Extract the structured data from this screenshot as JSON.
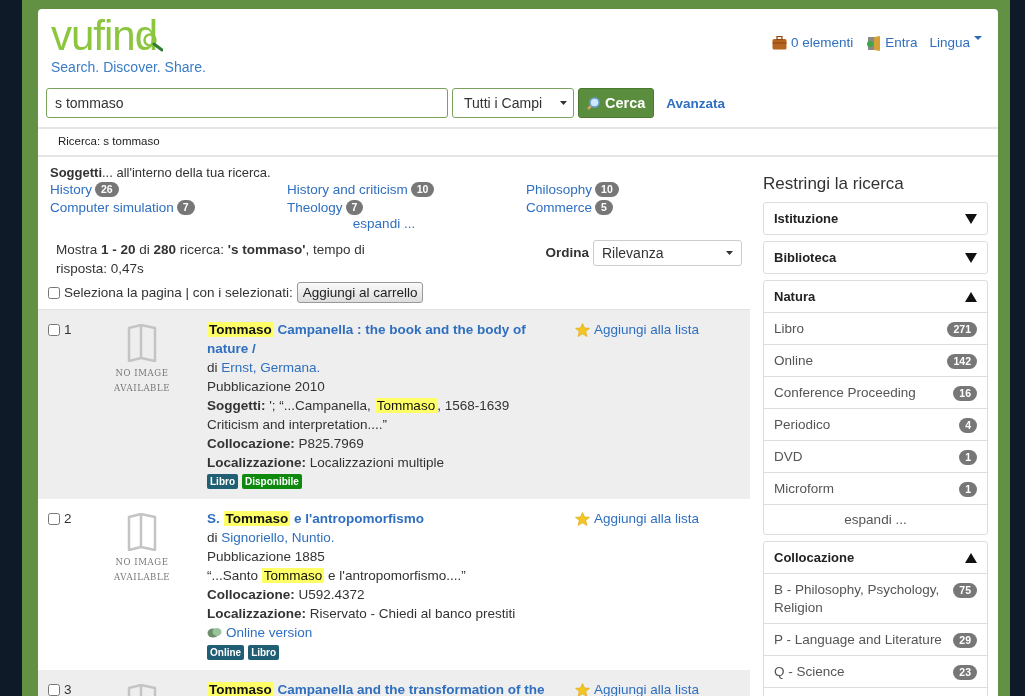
{
  "header": {
    "logo": "vufind",
    "tagline": "Search. Discover. Share.",
    "cart": "0 elementi",
    "login": "Entra",
    "language": "Lingua"
  },
  "search": {
    "value": "s tommaso",
    "type": "Tutti i Campi",
    "button": "Cerca",
    "advanced": "Avanzata"
  },
  "breadcrumb": "Ricerca: s tommaso",
  "subjects": {
    "intro": "**Soggetti**... all'interno della tua ricerca.",
    "items": [
      {
        "label": "History",
        "count": "26"
      },
      {
        "label": "History and criticism",
        "count": "10"
      },
      {
        "label": "Philosophy",
        "count": "10"
      },
      {
        "label": "Computer simulation",
        "count": "7"
      },
      {
        "label": "Theology",
        "count": "7"
      },
      {
        "label": "Commerce",
        "count": "5"
      }
    ],
    "more": "espandi ..."
  },
  "summary": "Mostra **1 - 20** di **280** ricerca: **'s tommaso'**, tempo di risposta: 0,47s",
  "sort": {
    "label": "Ordina",
    "value": "Rilevanza"
  },
  "bulk": {
    "checked": false,
    "label": "Seleziona la pagina | con i selezionati:",
    "button": "Aggiungi al carrello"
  },
  "results": [
    {
      "number": "1",
      "checked": false,
      "no_image": "NO IMAGE AVAILABLE",
      "title": [
        {
          "text": "Tommaso",
          "highlight": true
        },
        {
          "text": " Campanella : the book and the body of nature /",
          "highlight": false
        }
      ],
      "save": "Aggiungi alla lista",
      "details": [
        {
          "kind": "author",
          "prefix": "di",
          "name": "Ernst, Germana."
        },
        {
          "kind": "text",
          "text": "Pubblicazione 2010"
        },
        {
          "kind": "snippet",
          "label": "Soggetti:",
          "parts": [
            {
              "text": " '; “...Campanella, ",
              "highlight": false
            },
            {
              "text": "Tommaso",
              "highlight": true
            },
            {
              "text": ", 1568-1639 Criticism and interpretation....”",
              "highlight": false
            }
          ]
        },
        {
          "kind": "field",
          "label": "Collocazione:",
          "value": "P825.7969"
        },
        {
          "kind": "field",
          "label": "Localizzazione:",
          "value": "Localizzazioni multiple"
        },
        {
          "kind": "badges",
          "badges": [
            {
              "text": "Libro",
              "color": "#1f5e73"
            },
            {
              "text": "Disponibile",
              "color": "#0d8a0d"
            }
          ]
        }
      ]
    },
    {
      "number": "2",
      "checked": false,
      "no_image": "NO IMAGE AVAILABLE",
      "title": [
        {
          "text": "S. ",
          "highlight": false
        },
        {
          "text": "Tommaso",
          "highlight": true
        },
        {
          "text": " e l'antropomorfismo",
          "highlight": false
        }
      ],
      "save": "Aggiungi alla lista",
      "details": [
        {
          "kind": "author",
          "prefix": "di",
          "name": "Signoriello, Nuntio."
        },
        {
          "kind": "text",
          "text": "Pubblicazione 1885"
        },
        {
          "kind": "snippet",
          "parts": [
            {
              "text": "“...Santo ",
              "highlight": false
            },
            {
              "text": "Tommaso",
              "highlight": true
            },
            {
              "text": " e l'antropomorfismo....”",
              "highlight": false
            }
          ]
        },
        {
          "kind": "field",
          "label": "Collocazione:",
          "value": "U592.4372"
        },
        {
          "kind": "field",
          "label": "Localizzazione:",
          "value": "Riservato - Chiedi al banco prestiti"
        },
        {
          "kind": "link",
          "text": "Online version"
        },
        {
          "kind": "badges",
          "badges": [
            {
              "text": "Online",
              "color": "#1f5e73"
            },
            {
              "text": "Libro",
              "color": "#1f5e73"
            }
          ]
        }
      ]
    },
    {
      "number": "3",
      "checked": false,
      "title": [
        {
          "text": "Tommaso",
          "highlight": true
        },
        {
          "text": " Campanella and the transformation of the",
          "highlight": false
        }
      ],
      "save": "Aggiungi alla lista"
    }
  ],
  "sidebar": {
    "title": "Restringi la ricerca",
    "facets": [
      {
        "title": "Istituzione",
        "expanded": false
      },
      {
        "title": "Biblioteca",
        "expanded": false
      },
      {
        "title": "Natura",
        "expanded": true,
        "items": [
          {
            "label": "Libro",
            "count": "271"
          },
          {
            "label": "Online",
            "count": "142"
          },
          {
            "label": "Conference Proceeding",
            "count": "16"
          },
          {
            "label": "Periodico",
            "count": "4"
          },
          {
            "label": "DVD",
            "count": "1"
          },
          {
            "label": "Microform",
            "count": "1"
          }
        ],
        "more": "espandi ..."
      },
      {
        "title": "Collocazione",
        "expanded": true,
        "items": [
          {
            "label": "B - Philosophy, Psychology, Religion",
            "count": "75"
          },
          {
            "label": "P - Language and Literature",
            "count": "29"
          },
          {
            "label": "Q - Science",
            "count": "23"
          }
        ]
      }
    ]
  }
}
